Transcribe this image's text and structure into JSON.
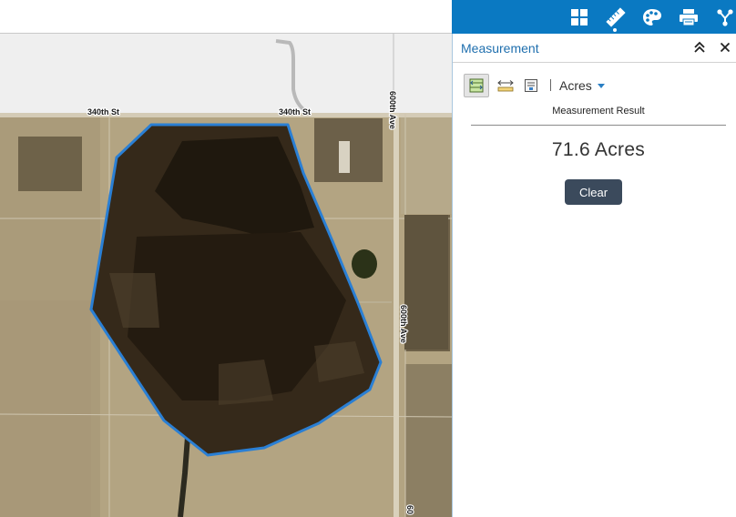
{
  "toolbar": {
    "tools": [
      {
        "name": "basemap-gallery",
        "icon": "grid-icon"
      },
      {
        "name": "measurement",
        "icon": "ruler-icon",
        "active": true
      },
      {
        "name": "draw",
        "icon": "palette-icon"
      },
      {
        "name": "print",
        "icon": "printer-icon"
      },
      {
        "name": "share",
        "icon": "share-icon"
      }
    ],
    "background": "#0a79c2"
  },
  "panel": {
    "title": "Measurement",
    "collapse_icon": "double-chevron-up-icon",
    "close_icon": "close-icon",
    "measure_tools": [
      {
        "name": "area",
        "icon": "area-icon",
        "selected": true
      },
      {
        "name": "distance",
        "icon": "distance-icon",
        "selected": false
      },
      {
        "name": "location",
        "icon": "location-icon",
        "selected": false
      }
    ],
    "separator": "|",
    "unit": "Acres",
    "result_heading": "Measurement Result",
    "result_value": "71.6 Acres",
    "clear_label": "Clear"
  },
  "map": {
    "road_labels": {
      "north_left": "340th St",
      "north_right": "340th St",
      "east_top": "600th Ave",
      "east_mid": "600th Ave",
      "east_bottom": "60"
    },
    "measurement_color": "#2a7fd4"
  }
}
